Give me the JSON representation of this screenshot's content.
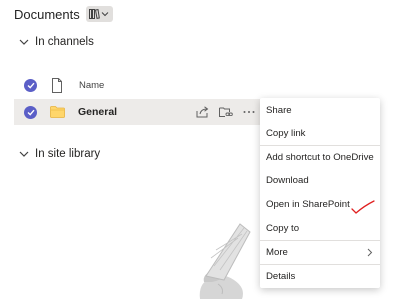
{
  "header": {
    "title": "Documents"
  },
  "sections": {
    "in_channels": "In channels",
    "in_site_library": "In site library"
  },
  "list": {
    "column_name": "Name",
    "rows": [
      {
        "name": "General"
      }
    ]
  },
  "context_menu": {
    "items": [
      "Share",
      "Copy link",
      "Add shortcut to OneDrive",
      "Download",
      "Open in SharePoint",
      "Copy to",
      "More",
      "Details"
    ]
  },
  "colors": {
    "accent": "#5b5fc7",
    "folder": "#ffd66b",
    "annotation": "#e02020"
  },
  "icons": [
    "library-view-icon",
    "chevron-down-icon",
    "file-type-icon",
    "folder-icon",
    "share-icon",
    "copy-link-icon",
    "more-options-icon",
    "chevron-right-icon",
    "checkmark-icon"
  ]
}
